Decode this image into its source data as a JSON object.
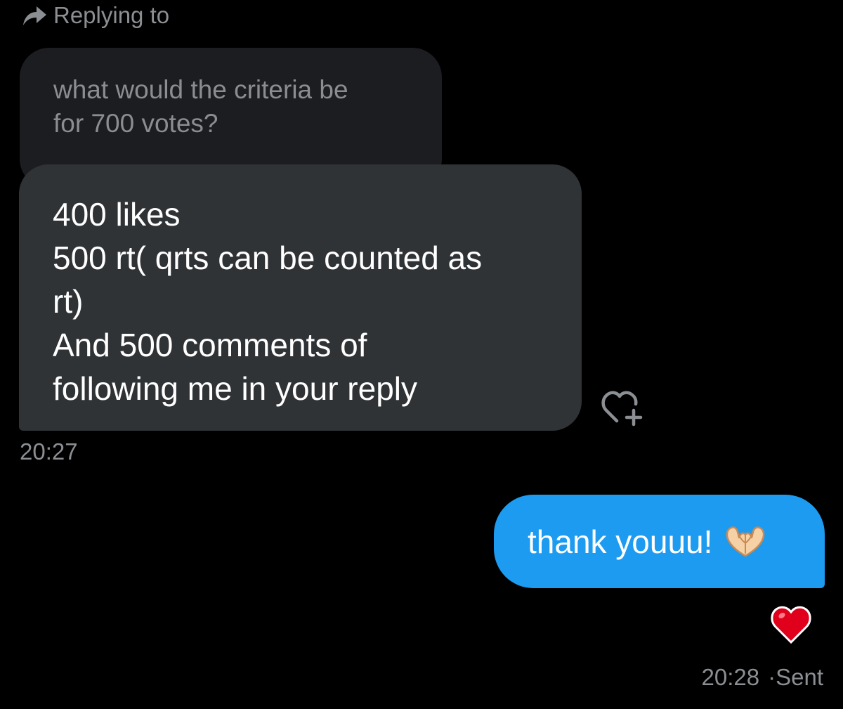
{
  "reply_header": {
    "icon": "reply-arrow-icon",
    "label": "Replying to"
  },
  "quoted_message": {
    "text": "what would the criteria be\nfor 700 votes?"
  },
  "received_message": {
    "text": "400 likes\n500 rt( qrts can be counted as\nrt)\nAnd 500 comments of\nfollowing me in your reply",
    "timestamp": "20:27",
    "reaction_button_icon": "heart-plus-icon"
  },
  "sent_message": {
    "text": "thank youuu!",
    "emoji_icon": "heart-hands-emoji-icon",
    "reaction_icon": "red-heart-reaction-icon",
    "timestamp": "20:28",
    "status": "·Sent"
  },
  "colors": {
    "background": "#000000",
    "quoted_bubble": "#1c1d20",
    "received_bubble": "#303336",
    "sent_bubble": "#1d9bf0",
    "muted_text": "#8b8e92",
    "reaction_heart": "#e0001b"
  }
}
